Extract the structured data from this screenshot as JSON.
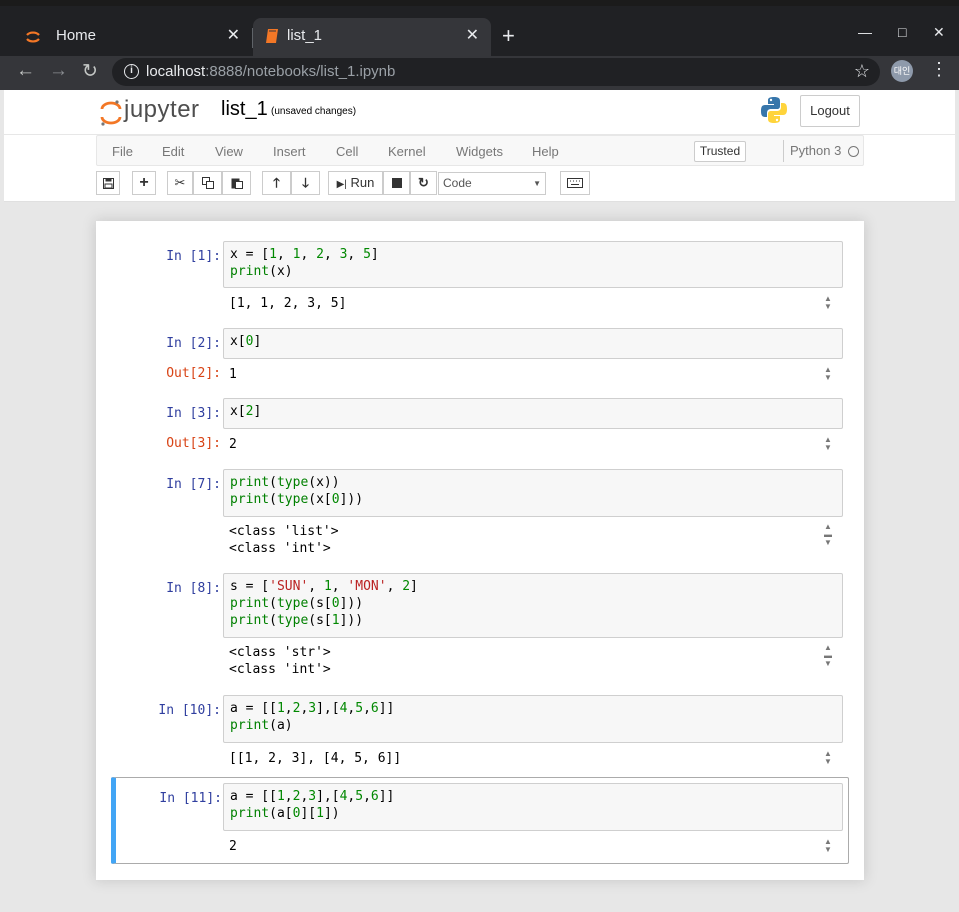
{
  "browser": {
    "tabs": [
      {
        "label": "Home",
        "active": false
      },
      {
        "label": "list_1",
        "active": true
      }
    ],
    "url_host": "localhost",
    "url_rest": ":8888/notebooks/list_1.ipynb",
    "profile_label": "대인"
  },
  "jupyter": {
    "logo_text": "jupyter",
    "notebook_name": "list_1",
    "save_status": "(unsaved changes)",
    "logout_label": "Logout",
    "menu": [
      "File",
      "Edit",
      "View",
      "Insert",
      "Cell",
      "Kernel",
      "Widgets",
      "Help"
    ],
    "trusted_label": "Trusted",
    "kernel_name": "Python 3",
    "run_label": "Run",
    "cell_type": "Code"
  },
  "cells": [
    {
      "in": "In [1]:",
      "out_prompt": "",
      "output": "[1, 1, 2, 3, 5]"
    },
    {
      "in": "In [2]:",
      "out_prompt": "Out[2]:",
      "output": "1"
    },
    {
      "in": "In [3]:",
      "out_prompt": "Out[3]:",
      "output": "2"
    },
    {
      "in": "In [7]:",
      "out_prompt": "",
      "output": "<class 'list'>\n<class 'int'>"
    },
    {
      "in": "In [8]:",
      "out_prompt": "",
      "output": "<class 'str'>\n<class 'int'>"
    },
    {
      "in": "In [10]:",
      "out_prompt": "",
      "output": "[[1, 2, 3], [4, 5, 6]]"
    },
    {
      "in": "In [11]:",
      "out_prompt": "",
      "output": "2"
    }
  ],
  "colors": {
    "selected_border": "#42a5f5",
    "in_prompt": "#303f9f",
    "out_prompt": "#d84315"
  }
}
